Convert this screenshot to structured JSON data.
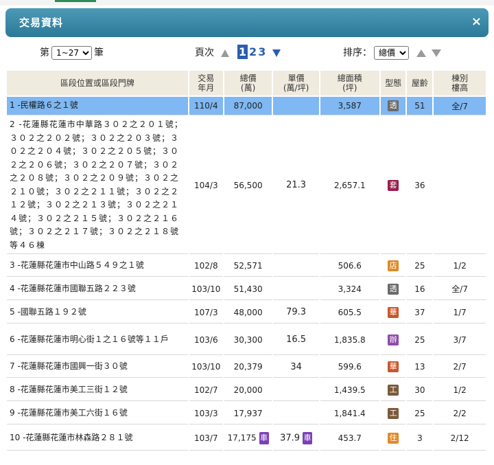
{
  "dialog": {
    "title": "交易資料",
    "close_icon": "×"
  },
  "controls": {
    "per_page_prefix": "第",
    "per_page_value": "1~27",
    "per_page_suffix": "筆",
    "page_label": "頁次",
    "pages": [
      "1",
      "2",
      "3"
    ],
    "current_page": "1",
    "sort_label": "排序：",
    "sort_value": "總價"
  },
  "table": {
    "headers": [
      "區段位置或區段門牌",
      "交易\n年月",
      "總價\n(萬)",
      "單價\n(萬/坪)",
      "總面積\n(坪)",
      "型態",
      "屋齡",
      "棟別\n樓高"
    ],
    "rows": [
      {
        "loc": "1 -民權路６之１號",
        "date": "110/4",
        "total": "87,000",
        "unit": "",
        "area": "3,587",
        "type": "透",
        "type_color": "#6a6a6a",
        "age": "51",
        "floor": "全/7"
      },
      {
        "loc": "2 -花蓮縣花蓮市中華路３０２之２０１號；３０２之２０２號；３０２之２０３號；３０２之２０４號；３０２之２０５號；３０２之２０６號；３０２之２０７號；３０２之２０８號；３０２之２０９號；３０２之２１０號；３０２之２１１號；３０２之２１２號；３０２之２１３號；３０２之２１４號；３０２之２１５號；３０２之２１６號；３０２之２１７號；３０２之２１８號等４６棟",
        "date": "104/3",
        "total": "56,500",
        "unit": "21.3",
        "area": "2,657.1",
        "type": "套",
        "type_color": "#9c1c4c",
        "age": "36",
        "floor": ""
      },
      {
        "loc": "3 -花蓮縣花蓮市中山路５４９之１號",
        "date": "102/8",
        "total": "52,571",
        "unit": "",
        "area": "506.6",
        "type": "店",
        "type_color": "#e08a28",
        "age": "25",
        "floor": "1/2"
      },
      {
        "loc": "4 -花蓮縣花蓮市國聯五路２２３號",
        "date": "103/10",
        "total": "51,430",
        "unit": "",
        "area": "3,324",
        "type": "透",
        "type_color": "#6a6a6a",
        "age": "16",
        "floor": "全/7"
      },
      {
        "loc": "5 -國聯五路１９２號",
        "date": "107/3",
        "total": "48,000",
        "unit": "79.3",
        "area": "605.5",
        "type": "華",
        "type_color": "#c9572c",
        "age": "37",
        "floor": "1/7"
      },
      {
        "loc": "6 -花蓮縣花蓮市明心街１之１６號等１１戶",
        "date": "103/6",
        "total": "30,300",
        "unit": "16.5",
        "area": "1,835.8",
        "type": "辦",
        "type_color": "#8e4aa8",
        "age": "25",
        "floor": "3/7"
      },
      {
        "loc": "7 -花蓮縣花蓮市國興一街３０號",
        "date": "103/10",
        "total": "20,379",
        "unit": "34",
        "area": "599.6",
        "type": "華",
        "type_color": "#c9572c",
        "age": "13",
        "floor": "2/7"
      },
      {
        "loc": "8 -花蓮縣花蓮市美工三街１２號",
        "date": "102/7",
        "total": "20,000",
        "unit": "",
        "area": "1,439.5",
        "type": "工",
        "type_color": "#7a5a3a",
        "age": "30",
        "floor": "1/2"
      },
      {
        "loc": "9 -花蓮縣花蓮市美工六街１６號",
        "date": "103/3",
        "total": "17,937",
        "unit": "",
        "area": "1,841.4",
        "type": "工",
        "type_color": "#7a5a3a",
        "age": "25",
        "floor": "2/2"
      },
      {
        "loc": "10 -花蓮縣花蓮市林森路２８１號",
        "date": "103/7",
        "total": "17,175",
        "total_tag": "車",
        "unit": "37.9",
        "unit_tag": "車",
        "area": "453.7",
        "type": "住",
        "type_color": "#e08a28",
        "age": "3",
        "floor": "2/12"
      }
    ]
  }
}
